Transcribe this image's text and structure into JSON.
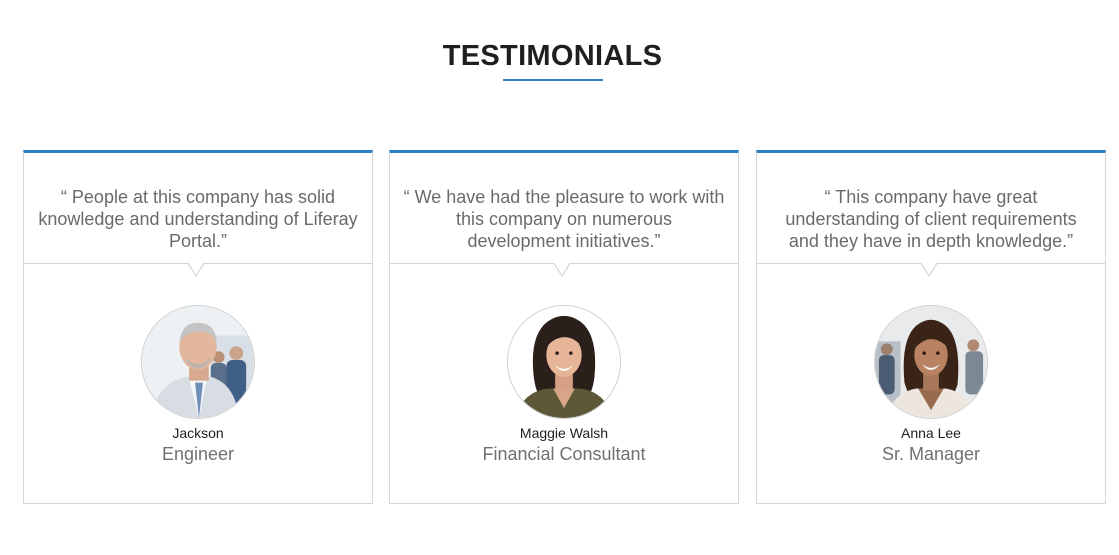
{
  "section": {
    "title": "TESTIMONIALS",
    "accent_color": "#2f7fc8"
  },
  "testimonials": [
    {
      "quote": "“ People at this company has solid knowledge and understanding of Liferay Portal.”",
      "name": "Jackson",
      "role": "Engineer",
      "avatar": "man-portrait-photo"
    },
    {
      "quote": "“ We have had the pleasure to work with this company on numerous development initiatives.”",
      "name": "Maggie Walsh",
      "role": "Financial Consultant",
      "avatar": "woman-portrait-photo"
    },
    {
      "quote": "“ This company have great understanding of client requirements and they have in depth knowledge.”",
      "name": "Anna Lee",
      "role": "Sr. Manager",
      "avatar": "woman-portrait-photo"
    }
  ]
}
